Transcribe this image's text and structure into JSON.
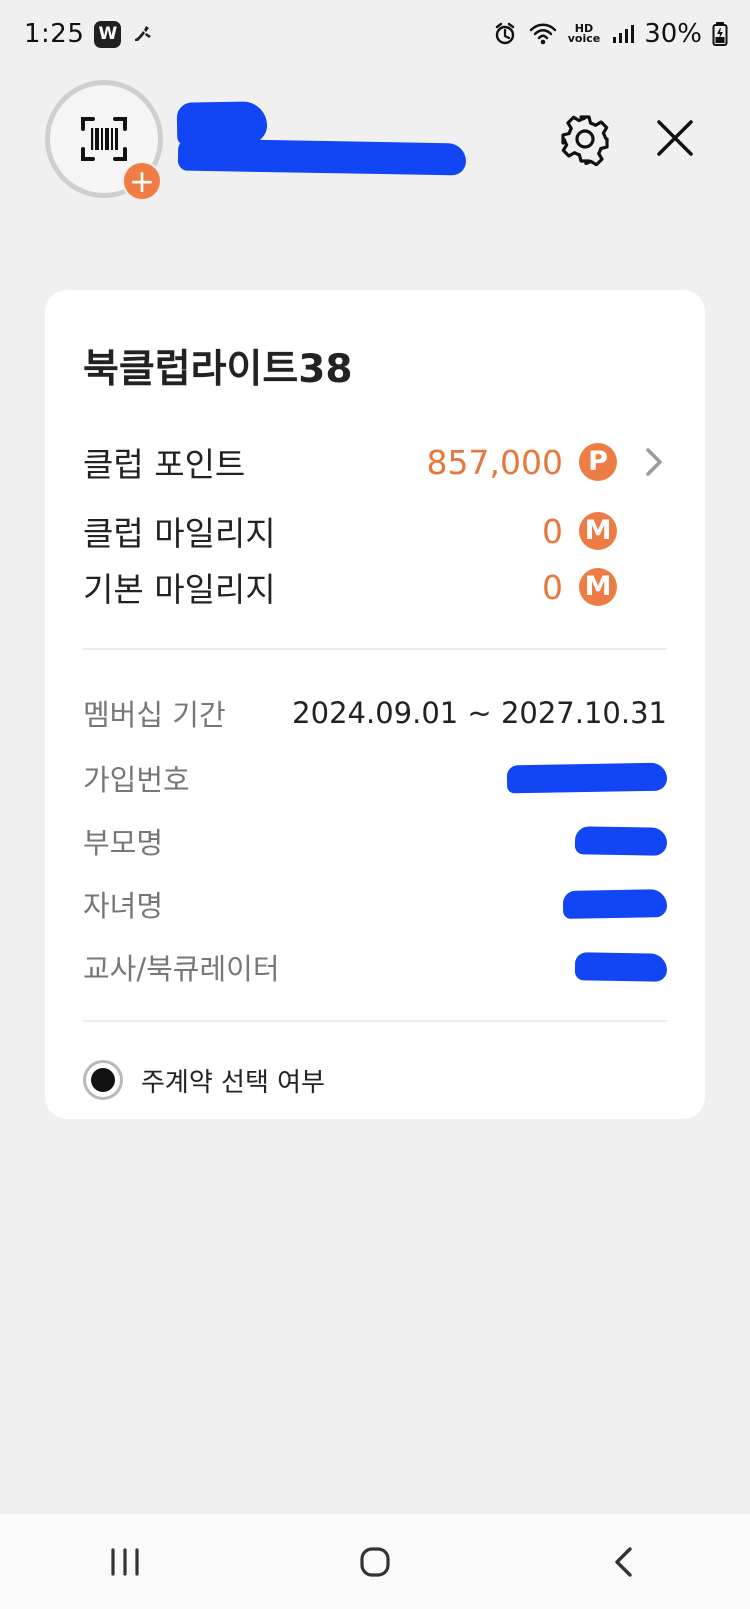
{
  "status_bar": {
    "time": "1:25",
    "app_badge": "W",
    "hd_label": "HD",
    "voice_label": "voice",
    "battery": "30%",
    "icons": [
      "sneaker-icon",
      "alarm-icon",
      "wifi-icon",
      "signal-icon",
      "battery-icon"
    ]
  },
  "header": {
    "icons": [
      "barcode-icon",
      "plus-icon",
      "gear-icon",
      "close-icon"
    ],
    "plus_symbol": "+",
    "accent_color": "#ee7d45"
  },
  "card": {
    "title": "북클럽라이트38",
    "points": [
      {
        "label": "클럽 포인트",
        "value": "857,000",
        "badge": "P"
      },
      {
        "label": "클럽 마일리지",
        "value": "0",
        "badge": "M"
      },
      {
        "label": "기본 마일리지",
        "value": "0",
        "badge": "M"
      }
    ],
    "info": [
      {
        "label": "멤버십 기간",
        "value": "2024.09.01 ~ 2027.10.31"
      },
      {
        "label": "가입번호"
      },
      {
        "label": "부모명"
      },
      {
        "label": "자녀명"
      },
      {
        "label": "교사/북큐레이터"
      }
    ],
    "radio_label": "주계약 선택 여부"
  },
  "navigation": {
    "icons": [
      "recent-apps-icon",
      "home-icon",
      "back-icon"
    ]
  }
}
